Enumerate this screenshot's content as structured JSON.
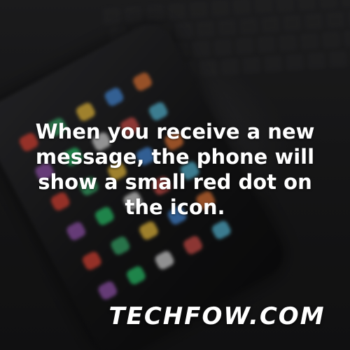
{
  "caption": {
    "text": "When you receive a new message, the phone will show a small red dot on the icon."
  },
  "watermark": {
    "text": "TECHFOW.COM"
  },
  "background": {
    "image_subject": "blurred-smartphone-and-keyboard-photo",
    "app_icon_colors": [
      "#e5483a",
      "#3cb371",
      "#f4c542",
      "#4a90e2",
      "#e97a3a",
      "#9b59b6",
      "#2ecc71",
      "#e0e0e0",
      "#d9534f",
      "#5bc0de"
    ]
  }
}
